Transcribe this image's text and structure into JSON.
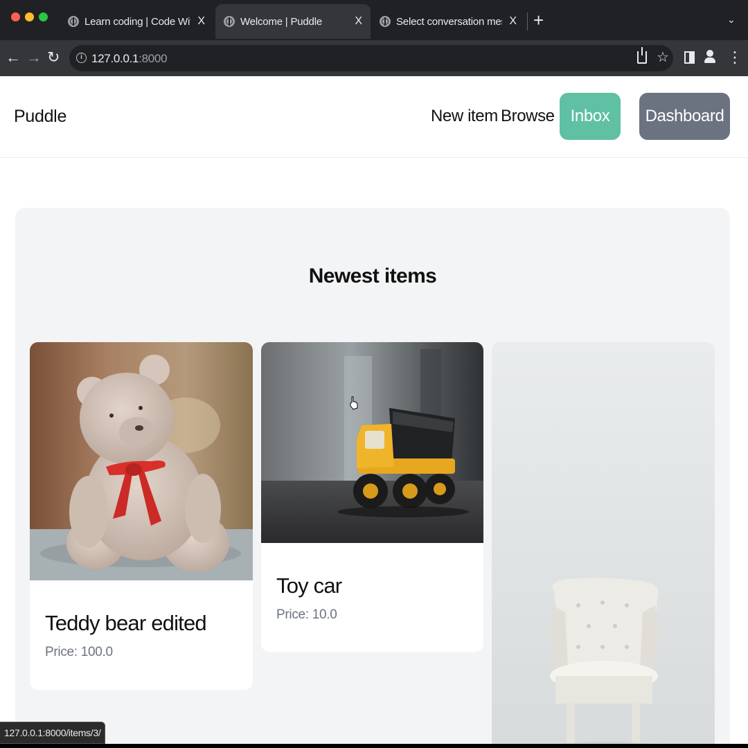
{
  "browser": {
    "tabs": [
      {
        "title": "Learn coding | Code With Stein",
        "close": "X",
        "active": false
      },
      {
        "title": "Welcome | Puddle",
        "close": "X",
        "active": true
      },
      {
        "title": "Select conversation message f",
        "close": "X",
        "active": false
      }
    ],
    "new_tab": "+",
    "tab_search": "⌄",
    "url_host": "127.0.0.1",
    "url_port": ":8000",
    "status_url": "127.0.0.1:8000/items/3/"
  },
  "site": {
    "brand": "Puddle",
    "nav": {
      "new_item": "New item",
      "browse": "Browse",
      "inbox": "Inbox",
      "dashboard": "Dashboard"
    },
    "colors": {
      "inbox": "#5fc0a4",
      "dashboard": "#6b7280"
    },
    "section_title": "Newest items",
    "items": [
      {
        "name": "Teddy bear edited",
        "price": "Price: 100.0"
      },
      {
        "name": "Toy car",
        "price": "Price: 10.0"
      },
      {
        "name": "",
        "price": ""
      }
    ]
  }
}
